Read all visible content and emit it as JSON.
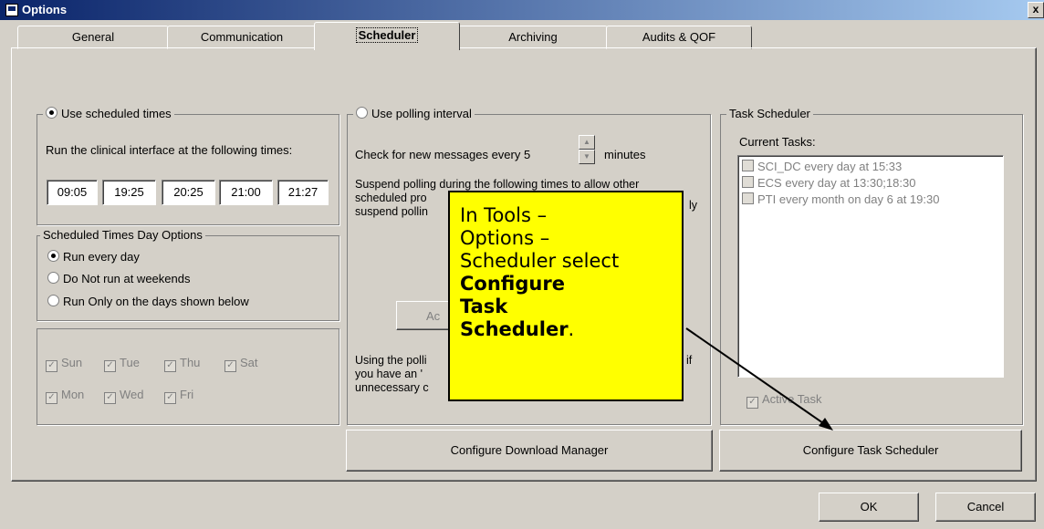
{
  "window": {
    "title": "Options",
    "close_label": "x"
  },
  "tabs": [
    {
      "label": "General"
    },
    {
      "label": "Communication"
    },
    {
      "label": "Scheduler"
    },
    {
      "label": "Archiving"
    },
    {
      "label": "Audits & QOF"
    }
  ],
  "scheduled": {
    "radio_label": "Use scheduled times",
    "run_text": "Run the clinical interface at the following times:",
    "times": [
      "09:05",
      "19:25",
      "20:25",
      "21:00",
      "21:27"
    ]
  },
  "day_options": {
    "legend": "Scheduled Times Day Options",
    "options": [
      "Run every day",
      "Do Not run at weekends",
      "Run Only on the days shown below"
    ]
  },
  "days": [
    "Sun",
    "Tue",
    "Thu",
    "Sat",
    "Mon",
    "Wed",
    "Fri"
  ],
  "polling": {
    "radio_label": "Use polling interval",
    "check_prefix": "Check for new messages every 5",
    "check_suffix": "minutes",
    "suspend_line1": "Suspend polling during the following times to allow other",
    "suspend_line2": "scheduled pro",
    "suspend_line2_end": "ly",
    "suspend_line3": "suspend pollin",
    "add_button": "Ac",
    "using_line1": "Using the polli",
    "using_line1_end": "if",
    "using_line2": "you have an '",
    "using_line3": "unnecessary c"
  },
  "task_scheduler": {
    "legend": "Task Scheduler",
    "current_label": "Current Tasks:",
    "tasks": [
      "SCI_DC every day at 15:33",
      "ECS every day at 13:30;18:30",
      "PTI every month on day 6 at 19:30"
    ],
    "active_task": "Active Task"
  },
  "buttons": {
    "download_manager": "Configure Download Manager",
    "task_scheduler": "Configure Task Scheduler",
    "ok": "OK",
    "cancel": "Cancel"
  },
  "callout": {
    "lines": [
      "In Tools –",
      "Options –",
      "Scheduler select"
    ],
    "bold1": "Configure",
    "bold2": "Task",
    "bold3": "Scheduler",
    "period": "."
  },
  "colors": {
    "title_start": "#0a246a",
    "title_end": "#a6caf0",
    "callout": "#ffff00",
    "face": "#d4d0c8"
  }
}
